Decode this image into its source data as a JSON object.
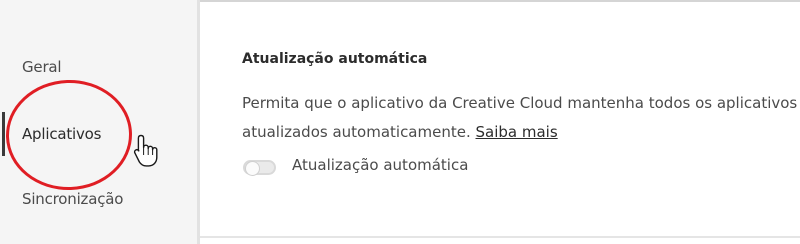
{
  "sidebar": {
    "items": [
      {
        "label": "Geral",
        "active": false
      },
      {
        "label": "Aplicativos",
        "active": true
      },
      {
        "label": "Sincronização",
        "active": false
      }
    ]
  },
  "annotation": {
    "color": "#e01e24"
  },
  "cursor": {
    "icon": "hand-pointer-icon"
  },
  "auto_update": {
    "title": "Atualização automática",
    "description_line1": "Permita que o aplicativo da Creative Cloud mantenha todos os aplicativos",
    "description_line2": "atualizados automaticamente.",
    "learn_more": "Saiba mais",
    "toggle_label": "Atualização automática",
    "toggle_on": false
  }
}
